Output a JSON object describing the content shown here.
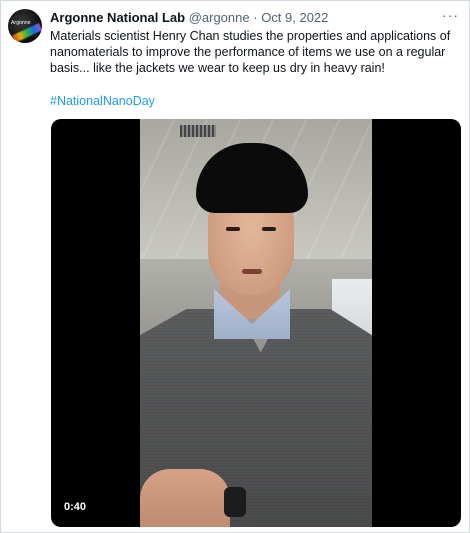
{
  "tweet": {
    "author_name": "Argonne National Lab",
    "handle": "@argonne",
    "separator": "·",
    "date": "Oct 9, 2022",
    "more_glyph": "···",
    "avatar_logo_text": "Argonne",
    "text": "Materials scientist Henry Chan studies the properties and applications of nanomaterials to improve the performance of items we use on a regular basis... like the jackets we wear to keep us dry in heavy rain!",
    "hashtag": "#NationalNanoDay",
    "video": {
      "duration": "0:40"
    }
  },
  "colors": {
    "text_primary": "#0f1419",
    "text_secondary": "#536471",
    "link": "#1d9bf0",
    "border": "#cfd9de"
  }
}
